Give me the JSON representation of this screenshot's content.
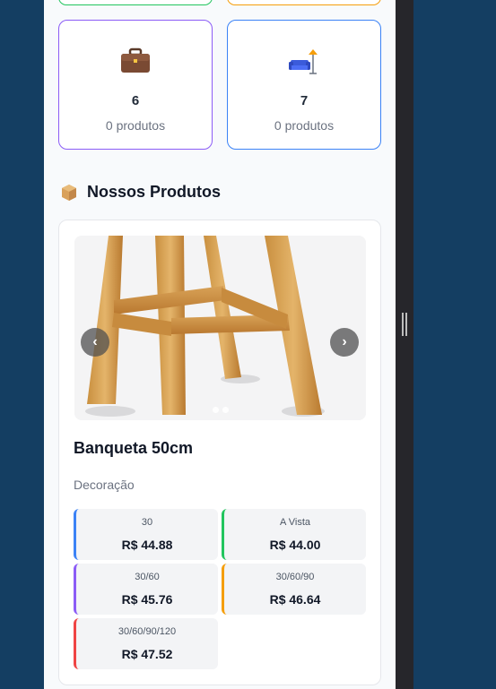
{
  "categories_top": [
    {
      "border_color": "#22c55e"
    },
    {
      "border_color": "#f59e0b"
    }
  ],
  "categories": [
    {
      "icon": "briefcase-icon",
      "name": "6",
      "count": "0 produtos",
      "border_color": "#8b5cf6"
    },
    {
      "icon": "sofa-lamp-icon",
      "name": "7",
      "count": "0 produtos",
      "border_color": "#3b82f6"
    }
  ],
  "section": {
    "icon": "package-icon",
    "title": "Nossos Produtos"
  },
  "product": {
    "name": "Banqueta 50cm",
    "category": "Decoração",
    "carousel": {
      "prev_label": "‹",
      "next_label": "›",
      "image_count": 2,
      "active_index": 0
    },
    "prices": [
      {
        "label": "30",
        "value": "R$ 44.88",
        "color": "#3b82f6"
      },
      {
        "label": "A Vista",
        "value": "R$ 44.00",
        "color": "#22c55e"
      },
      {
        "label": "30/60",
        "value": "R$ 45.76",
        "color": "#8b5cf6"
      },
      {
        "label": "30/60/90",
        "value": "R$ 46.64",
        "color": "#f59e0b"
      },
      {
        "label": "30/60/90/120",
        "value": "R$ 47.52",
        "color": "#ef4444"
      }
    ]
  }
}
